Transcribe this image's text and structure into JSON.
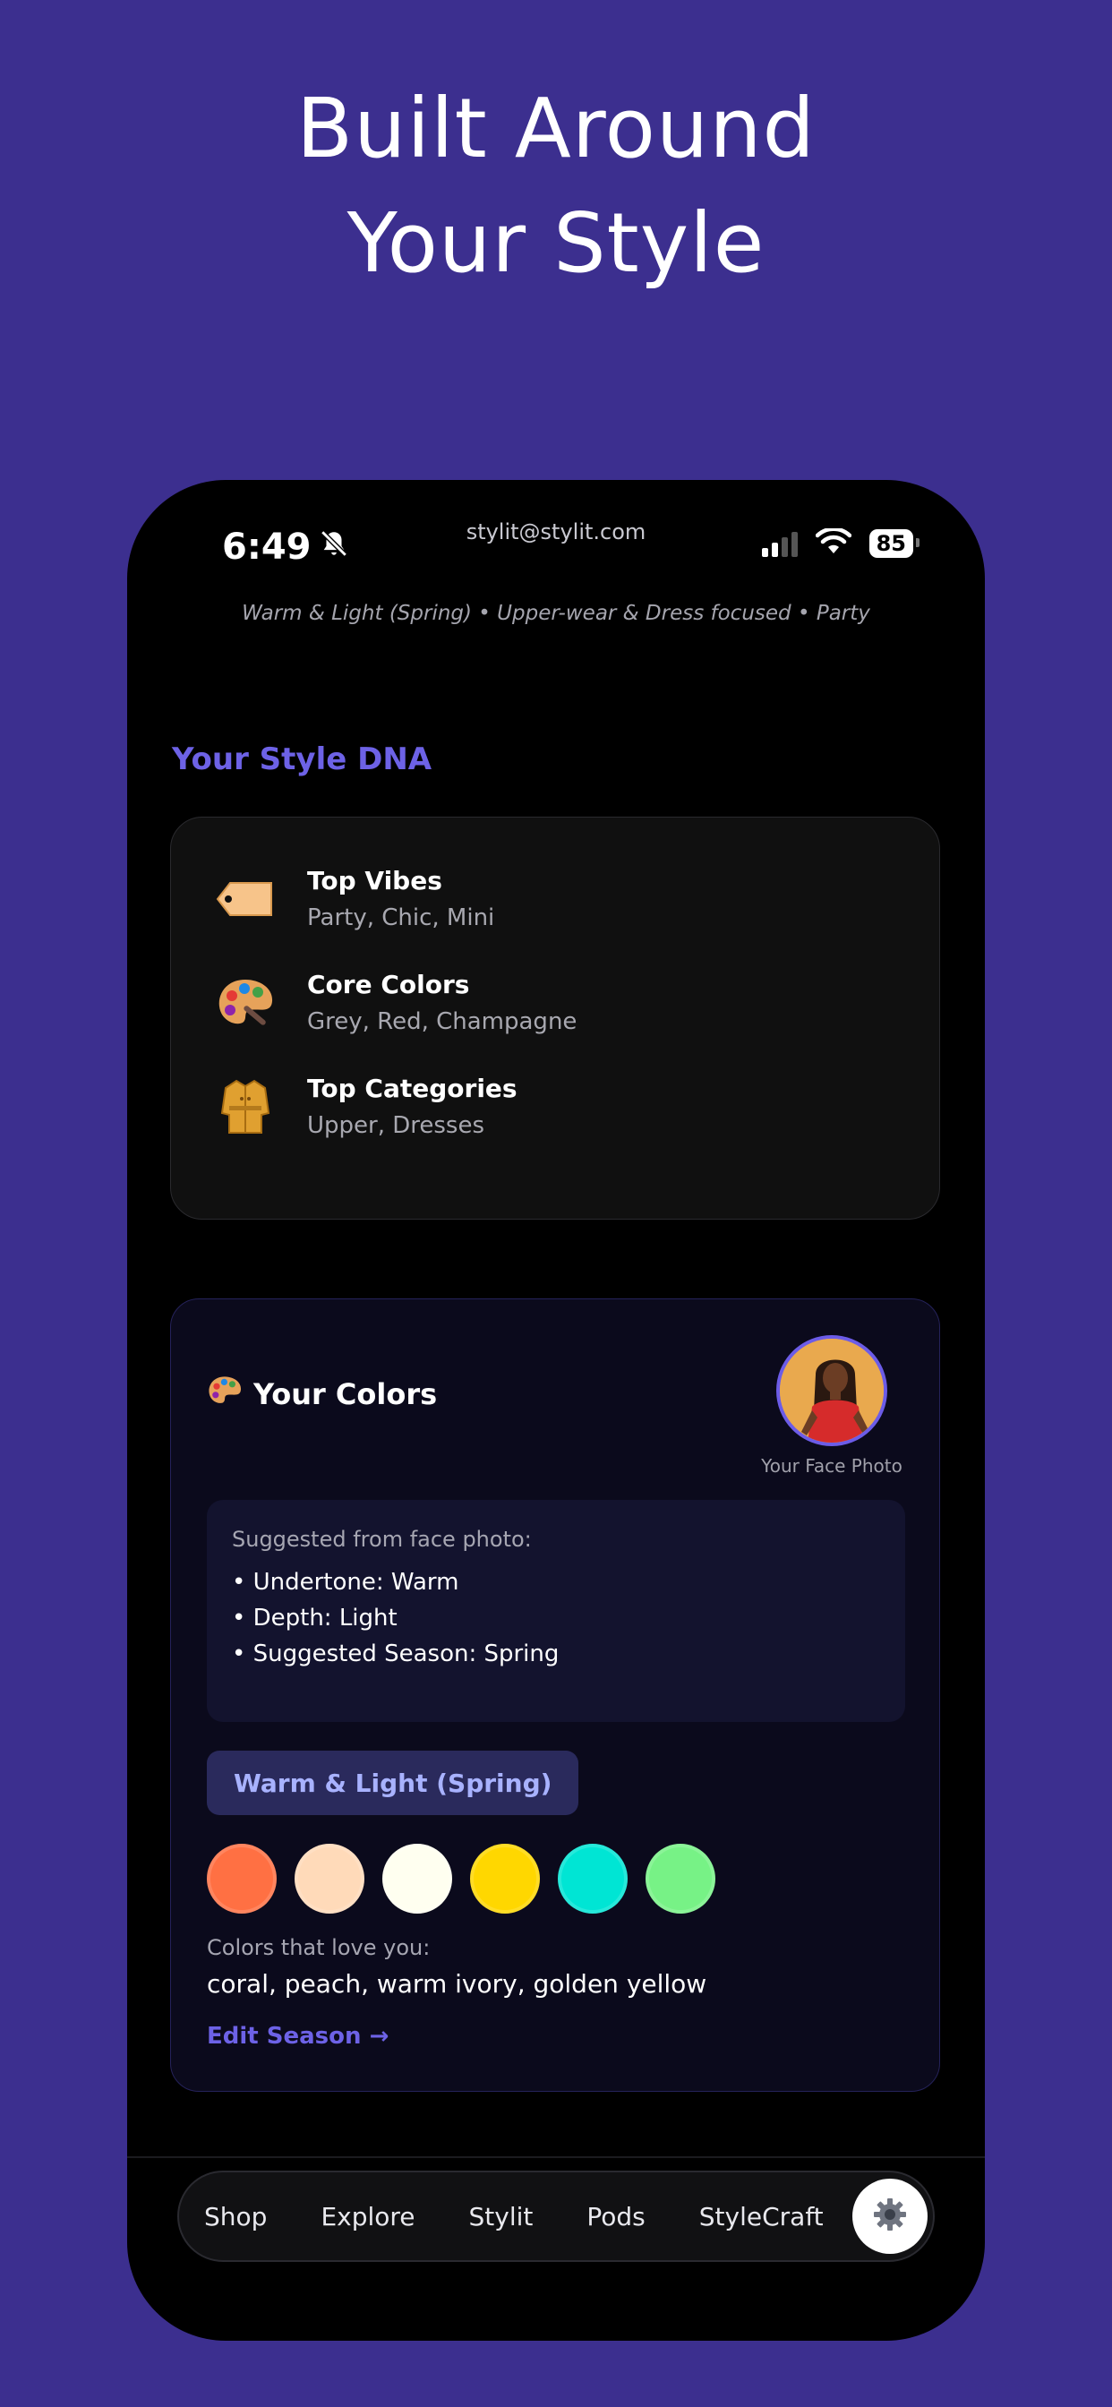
{
  "headline": {
    "line1": "Built Around",
    "line2": "Your Style"
  },
  "status_bar": {
    "time": "6:49",
    "email": "stylit@stylit.com",
    "battery": "85"
  },
  "profile_summary": "Warm & Light (Spring) • Upper-wear & Dress focused • Party",
  "style_dna": {
    "title": "Your Style DNA",
    "rows": [
      {
        "icon": "tag-icon",
        "title": "Top Vibes",
        "value": "Party, Chic, Mini"
      },
      {
        "icon": "palette-icon",
        "title": "Core Colors",
        "value": "Grey, Red, Champagne"
      },
      {
        "icon": "coat-icon",
        "title": "Top Categories",
        "value": "Upper, Dresses"
      }
    ]
  },
  "your_colors": {
    "title": "Your Colors",
    "face_photo_label": "Your Face Photo",
    "suggested_title": "Suggested from face photo:",
    "suggested_items": [
      "• Undertone: Warm",
      "• Depth: Light",
      "• Suggested Season: Spring"
    ],
    "season_label": "Warm & Light (Spring)",
    "swatches": [
      "#ff7043",
      "#ffdab9",
      "#fffff0",
      "#ffd700",
      "#00e5d4",
      "#77f286"
    ],
    "love_title": "Colors that love you:",
    "love_list": "coral, peach, warm ivory, golden yellow",
    "edit_label": "Edit Season →"
  },
  "tabbar": {
    "tabs": [
      "Shop",
      "Explore",
      "Stylit",
      "Pods",
      "StyleCraft"
    ],
    "settings_icon": "gear-icon"
  },
  "colors": {
    "background": "#3c2f8f",
    "accent": "#6d62e6"
  }
}
